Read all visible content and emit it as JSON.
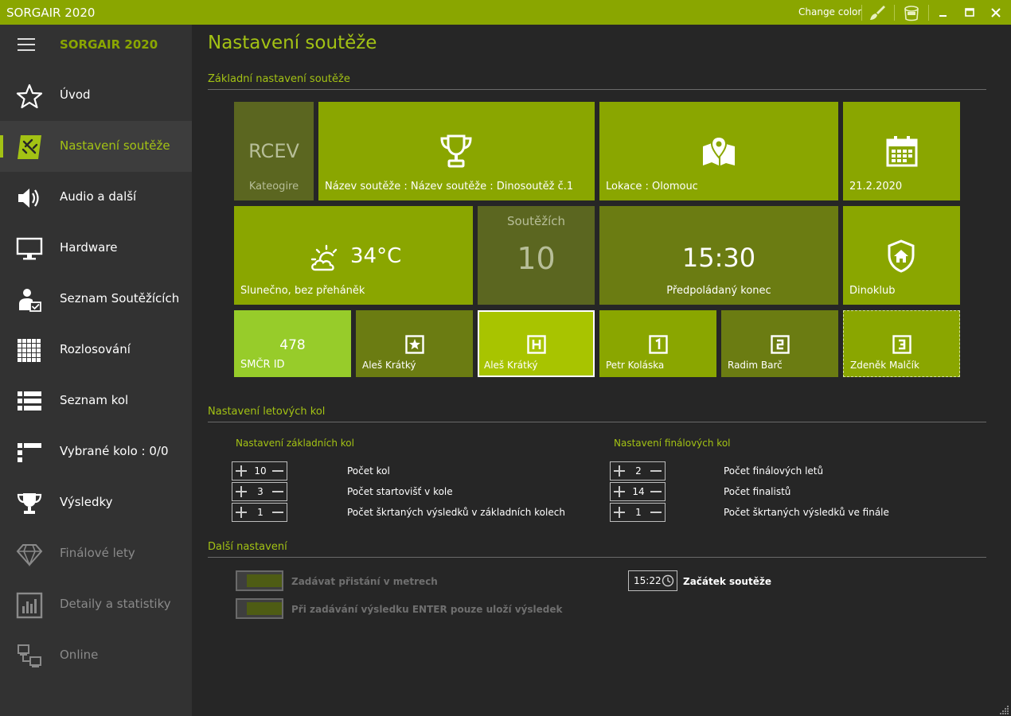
{
  "window": {
    "title": "SORGAIR 2020",
    "change_color_label": "Change color"
  },
  "sidebar": {
    "brand": "SORGAIR 2020",
    "items": [
      {
        "label": "Úvod",
        "icon": "star-icon"
      },
      {
        "label": "Nastavení soutěže",
        "icon": "plane-icon"
      },
      {
        "label": "Audio a další",
        "icon": "speaker-icon"
      },
      {
        "label": "Hardware",
        "icon": "monitor-icon"
      },
      {
        "label": "Seznam Soutěžících",
        "icon": "user-check-icon"
      },
      {
        "label": "Rozlosování",
        "icon": "grid-icon"
      },
      {
        "label": "Seznam kol",
        "icon": "list-icon"
      },
      {
        "label": "Vybrané kolo : 0/0",
        "icon": "bars-icon"
      },
      {
        "label": "Výsledky",
        "icon": "trophy-icon"
      },
      {
        "label": "Finálové lety",
        "icon": "diamond-icon"
      },
      {
        "label": "Detaily a statistiky",
        "icon": "chart-icon"
      },
      {
        "label": "Online",
        "icon": "network-icon"
      }
    ]
  },
  "page": {
    "title": "Nastavení soutěže",
    "basic_section": "Základní nastavení soutěže",
    "rounds_section": "Nastavení letových kol",
    "other_section": "Další nastavení"
  },
  "tiles": {
    "category_code": "RCEV",
    "category_label": "Kateogire",
    "name_label": "Název soutěže : Název soutěže : Dinosoutěž č.1",
    "location_label": "Lokace : Olomouc",
    "date_label": "21.2.2020",
    "weather_temp": "34°C",
    "weather_label": "Slunečno, bez přeháněk",
    "competitors_label": "Soutěžích",
    "competitors_count": "10",
    "end_time": "15:30",
    "end_label": "Předpoládaný konec",
    "club_label": "Dinoklub",
    "smcr_value": "478",
    "smcr_label": "SMČR ID",
    "director_label": "Aleš Krátký",
    "head_judge_label": "Aleš Krátký",
    "judge1_label": "Petr Koláska",
    "judge2_label": "Radim Barč",
    "judge3_label": "Zdeněk Malčík"
  },
  "basic_rounds": {
    "title": "Nastavení základních kol",
    "rows": [
      {
        "value": "10",
        "label": "Počet kol"
      },
      {
        "value": "3",
        "label": "Počet startovišť v kole"
      },
      {
        "value": "1",
        "label": "Počet škrtaných výsledků v základních kolech"
      }
    ]
  },
  "final_rounds": {
    "title": "Nastavení finálových kol",
    "rows": [
      {
        "value": "2",
        "label": "Počet finálových letů"
      },
      {
        "value": "14",
        "label": "Počet finalistů"
      },
      {
        "value": "1",
        "label": "Počet škrtaných výsledků ve finále"
      }
    ]
  },
  "other": {
    "toggle1_label": "Zadávat přistání v metrech",
    "toggle2_label": "Při zadávání výsledku ENTER pouze uloží výsledek",
    "start_time": "15:22",
    "start_label": "Začátek soutěže"
  },
  "colors": {
    "accent": "#8aa600",
    "accent_text": "#a3c214",
    "background": "#262626",
    "sidebar": "#323232"
  }
}
